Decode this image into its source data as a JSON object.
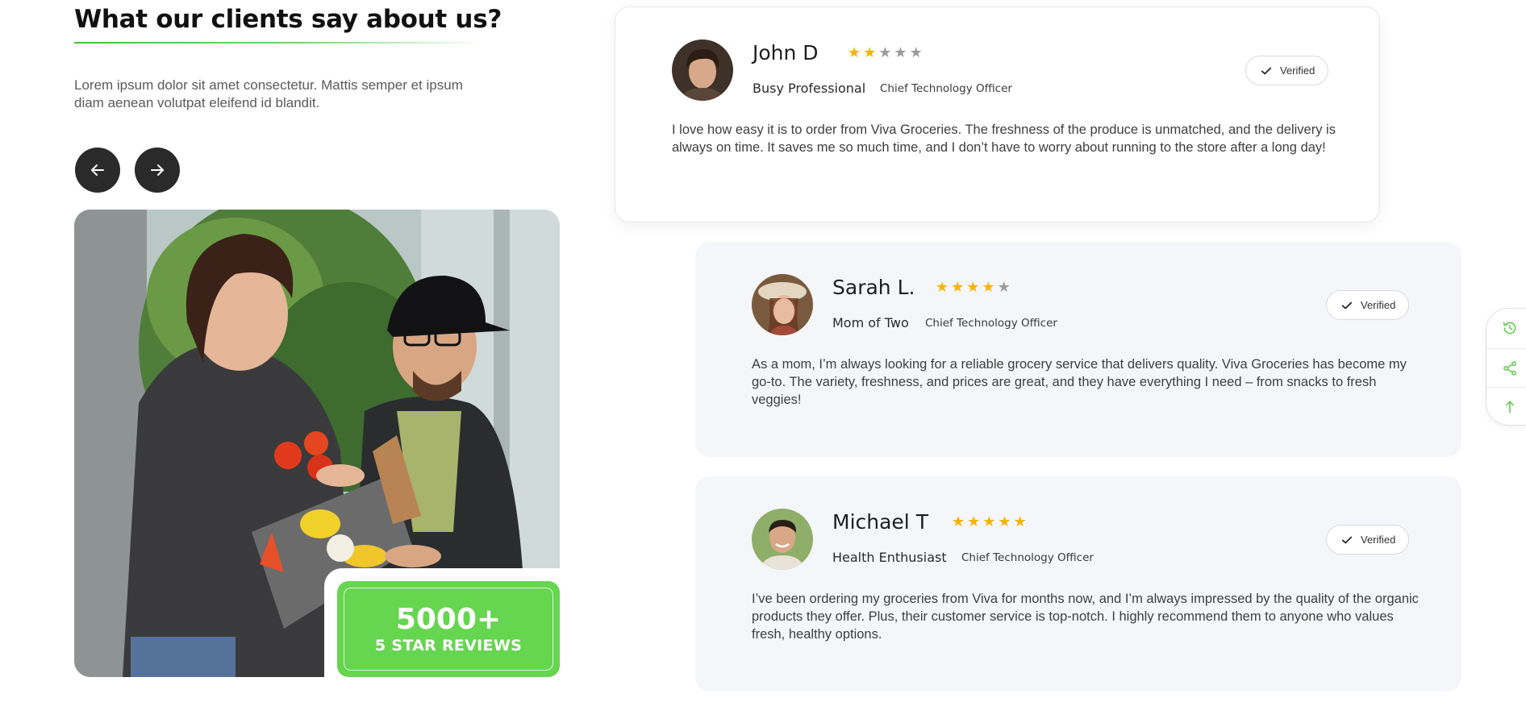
{
  "section": {
    "title": "What our clients say about us?",
    "intro": "Lorem ipsum dolor sit amet consectetur. Mattis semper et ipsum diam aenean volutpat eleifend id blandit."
  },
  "carousel": {
    "prev_icon": "arrow-left-icon",
    "next_icon": "arrow-right-icon"
  },
  "stat": {
    "number": "5000+",
    "label": "5 STAR REVIEWS"
  },
  "colors": {
    "accent": "#66d550",
    "star": "#f5b301",
    "star_off": "#9b9b9b",
    "nav_button": "#2a2a2a",
    "card_bg": "#f5f6f9"
  },
  "reviews": [
    {
      "name": "John D",
      "rating": 2,
      "max_rating": 5,
      "role": "Busy Professional",
      "title": "Chief Technology Officer",
      "verified_label": "Verified",
      "text": "I love how easy it is to order from Viva Groceries. The freshness of the produce is unmatched, and the delivery is always on time. It saves me so much time, and I don’t have to worry about running to the store after a long day!"
    },
    {
      "name": "Sarah L.",
      "rating": 4,
      "max_rating": 5,
      "role": "Mom of Two",
      "title": "Chief Technology Officer",
      "verified_label": "Verified",
      "text": "As a mom, I’m always looking for a reliable grocery service that delivers quality. Viva Groceries has become my go-to. The variety, freshness, and prices are great, and they have everything I need – from snacks to fresh veggies!"
    },
    {
      "name": "Michael T",
      "rating": 5,
      "max_rating": 5,
      "role": "Health Enthusiast",
      "title": "Chief Technology Officer",
      "verified_label": "Verified",
      "text": "I’ve been ordering my groceries from Viva for months now, and I’m always impressed by the quality of the organic products they offer. Plus, their customer service is top-notch. I highly recommend them to anyone who values fresh, healthy options."
    }
  ],
  "side_dock": {
    "items": [
      "history-icon",
      "share-icon",
      "arrow-up-icon"
    ]
  }
}
